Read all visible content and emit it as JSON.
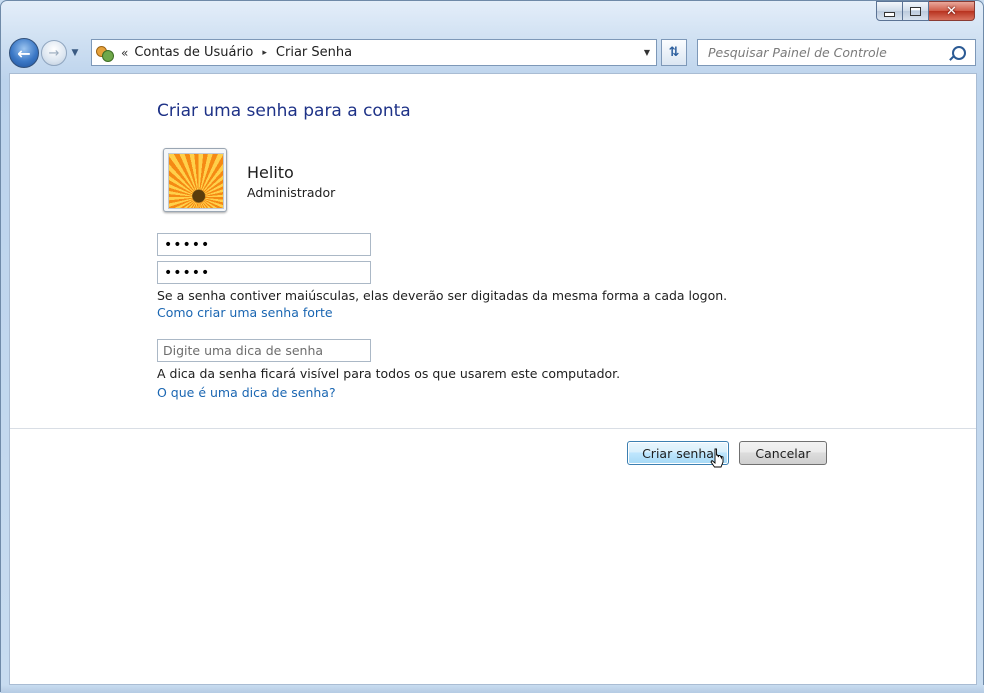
{
  "window": {
    "caption_buttons": {
      "minimize": "minimize",
      "maximize": "maximize",
      "close": "✕"
    }
  },
  "navigation": {
    "back_icon": "back-arrow-icon",
    "forward_icon": "forward-arrow-icon",
    "breadcrumb_prefix": "«",
    "breadcrumbs": [
      "Contas de Usuário",
      "Criar Senha"
    ],
    "breadcrumb_separator": "▸",
    "refresh_icon": "refresh-icon"
  },
  "search": {
    "placeholder": "Pesquisar Painel de Controle"
  },
  "main": {
    "title": "Criar uma senha para a conta",
    "user": {
      "name": "Helito",
      "type": "Administrador"
    },
    "new_password_value": "•••••",
    "confirm_password_value": "•••••",
    "case_sensitivity_note": "Se a senha contiver maiúsculas, elas deverão ser digitadas da mesma forma a cada logon.",
    "strong_password_link": "Como criar uma senha forte",
    "hint_placeholder": "Digite uma dica de senha",
    "hint_note": "A dica da senha ficará visível para todos os que usarem este computador.",
    "hint_help_link": "O que é uma dica de senha?"
  },
  "actions": {
    "create_label": "Criar senha",
    "cancel_label": "Cancelar"
  },
  "colors": {
    "title": "#1e3287",
    "link": "#1a66b2",
    "frame": "#c8dcf0"
  }
}
